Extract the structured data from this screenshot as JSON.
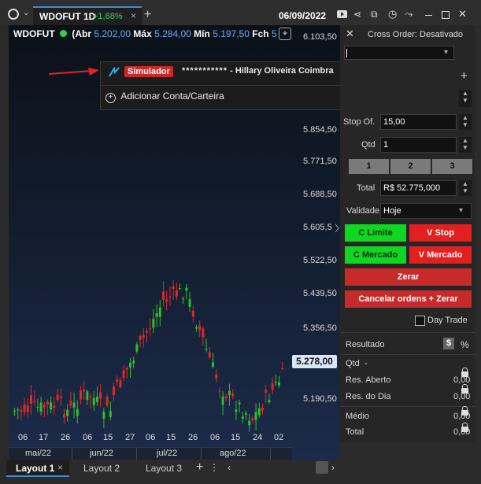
{
  "toolbar": {
    "symbol": "WDOFUT 1D",
    "change": "+1,68%",
    "close": "×",
    "add": "+",
    "date": "06/09/2022"
  },
  "ticker": {
    "name": "WDOFUT",
    "open_label": "(Abr",
    "open": "5.202,00",
    "max_label": "Máx",
    "max": "5.284,00",
    "min_label": "Mín",
    "min": "5.197,50",
    "close_label": "Fch",
    "close": "5",
    "add": "+"
  },
  "yaxis": [
    "6.103,50",
    "5.854,50",
    "5.771,50",
    "5.688,50",
    "5.605,5",
    "5.522,50",
    "5.439,50",
    "5.356,50",
    "5.190,50"
  ],
  "current_price": "5.278,00",
  "xaxis": {
    "days": [
      "06",
      "17",
      "26",
      "06",
      "15",
      "27",
      "06",
      "15",
      "26",
      "06",
      "15",
      "24",
      "02"
    ],
    "months": [
      "mai/22",
      "jun/22",
      "jul/22",
      "ago/22"
    ]
  },
  "chart_data": {
    "type": "candlestick",
    "series": [
      {
        "name": "WDOFUT",
        "values": []
      }
    ],
    "ylim": [
      5140,
      6130
    ]
  },
  "popup": {
    "badge": "Simulador",
    "account_mask": "***********",
    "account_owner": "- Hillary Oliveira Coimbra",
    "add_account": "Adicionar Conta/Carteira"
  },
  "order": {
    "cross_order": "Cross Order: Desativado",
    "stop_label": "Stop Of.",
    "stop_value": "15,00",
    "qtd_label": "Qtd",
    "qtd_value": "1",
    "preset1": "1",
    "preset2": "2",
    "preset3": "3",
    "total_label": "Total",
    "total_value": "R$ 52.775,000",
    "validade_label": "Validade",
    "validade_value": "Hoje",
    "c_limite": "C Limite",
    "v_stop": "V Stop",
    "c_mercado": "C Mercado",
    "v_mercado": "V Mercado",
    "zerar": "Zerar",
    "cancelar_zerar": "Cancelar ordens + Zerar",
    "day_trade": "Day Trade"
  },
  "result": {
    "title": "Resultado",
    "currency": "$",
    "percent": "%",
    "qtd_label": "Qtd",
    "qtd_value": "-",
    "aberto_label": "Res. Aberto",
    "aberto_value": "0,00",
    "dia_label": "Res. do Dia",
    "dia_value": "0,00",
    "medio_label": "Médio",
    "medio_value": "0,00",
    "total_label": "Total",
    "total_value": "0,00"
  },
  "bottom": {
    "layout1": "Layout 1",
    "layout1_close": "×",
    "layout2": "Layout 2",
    "layout3": "Layout 3",
    "add": "+",
    "more": "⋮"
  },
  "colors": {
    "up": "#2ec02a",
    "down": "#e02828",
    "accent": "#3d8bd8",
    "badge": "#c82828"
  }
}
